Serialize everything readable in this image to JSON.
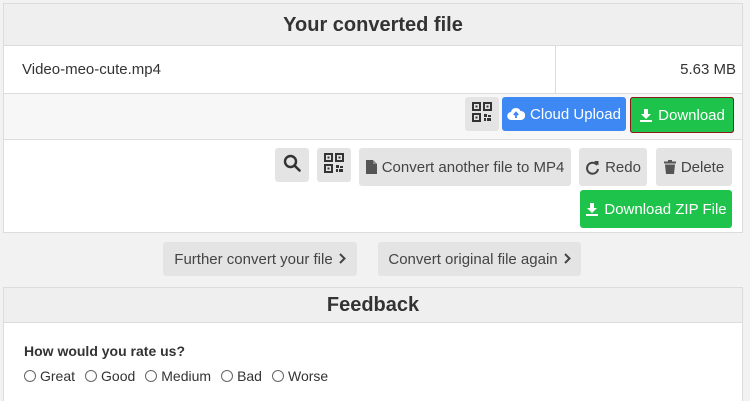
{
  "converted": {
    "title": "Your converted file",
    "file_name": "Video-meo-cute.mp4",
    "file_size": "5.63 MB",
    "cloud_upload_label": "Cloud Upload",
    "download_label": "Download",
    "convert_another_label": "Convert another file to MP4",
    "redo_label": "Redo",
    "delete_label": "Delete",
    "download_zip_label": "Download ZIP File"
  },
  "actions": {
    "further_convert_label": "Further convert your file",
    "convert_original_label": "Convert original file again"
  },
  "feedback": {
    "title": "Feedback",
    "question": "How would you rate us?",
    "options": [
      "Great",
      "Good",
      "Medium",
      "Bad",
      "Worse"
    ]
  },
  "colors": {
    "blue": "#3d88f2",
    "green": "#1ec34c"
  },
  "icons": {
    "qr": "qr-code-icon",
    "cloud": "cloud-upload-icon",
    "download": "download-icon",
    "search": "search-icon",
    "file": "file-icon",
    "redo": "redo-icon",
    "delete": "trash-icon",
    "chevron": "chevron-right-icon"
  }
}
